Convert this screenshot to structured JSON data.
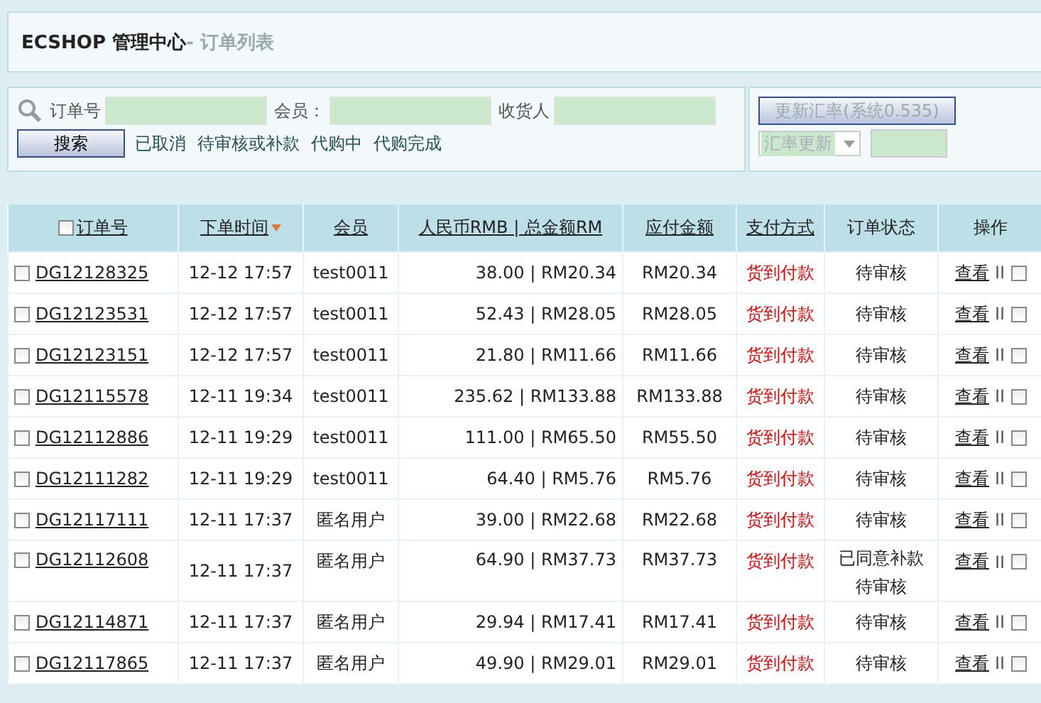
{
  "header": {
    "brand": "ECSHOP 管理中心",
    "page": "- 订单列表"
  },
  "search": {
    "fields": [
      {
        "label": "订单号"
      },
      {
        "label": "会员："
      },
      {
        "label": "收货人"
      }
    ],
    "button": "搜索",
    "filters": [
      "已取消",
      "待审核或补款",
      "代购中",
      "代购完成"
    ]
  },
  "rate": {
    "button": "更新汇率(系统0.535)",
    "select": "汇率更新"
  },
  "table": {
    "select_all_checked": false,
    "columns": [
      {
        "label": "订单号",
        "link": true,
        "sorted": false
      },
      {
        "label": "下单时间",
        "link": true,
        "sorted": true
      },
      {
        "label": "会员",
        "link": true,
        "sorted": false
      },
      {
        "label": "人民币RMB | 总金额RM",
        "link": true,
        "sorted": false
      },
      {
        "label": "应付金额",
        "link": true,
        "sorted": false
      },
      {
        "label": "支付方式",
        "link": true,
        "sorted": false
      },
      {
        "label": "订单状态",
        "link": false
      },
      {
        "label": "操作",
        "link": false
      }
    ],
    "rows": [
      {
        "checked": false,
        "order": "DG12128325",
        "time": "12-12 17:57",
        "member": "test0011",
        "amount": "38.00 | RM20.34",
        "payable": "RM20.34",
        "payment": "货到付款",
        "status": [
          "待审核"
        ],
        "action": "查看",
        "separator": "II",
        "action_checked": false
      },
      {
        "checked": false,
        "order": "DG12123531",
        "time": "12-12 17:57",
        "member": "test0011",
        "amount": "52.43 | RM28.05",
        "payable": "RM28.05",
        "payment": "货到付款",
        "status": [
          "待审核"
        ],
        "action": "查看",
        "separator": "II",
        "action_checked": false
      },
      {
        "checked": false,
        "order": "DG12123151",
        "time": "12-12 17:57",
        "member": "test0011",
        "amount": "21.80 | RM11.66",
        "payable": "RM11.66",
        "payment": "货到付款",
        "status": [
          "待审核"
        ],
        "action": "查看",
        "separator": "II",
        "action_checked": false
      },
      {
        "checked": false,
        "order": "DG12115578",
        "time": "12-11 19:34",
        "member": "test0011",
        "amount": "235.62 | RM133.88",
        "payable": "RM133.88",
        "payment": "货到付款",
        "status": [
          "待审核"
        ],
        "action": "查看",
        "separator": "II",
        "action_checked": false
      },
      {
        "checked": false,
        "order": "DG12112886",
        "time": "12-11 19:29",
        "member": "test0011",
        "amount": "111.00 | RM65.50",
        "payable": "RM55.50",
        "payment": "货到付款",
        "status": [
          "待审核"
        ],
        "action": "查看",
        "separator": "II",
        "action_checked": false
      },
      {
        "checked": false,
        "order": "DG12111282",
        "time": "12-11 19:29",
        "member": "test0011",
        "amount": "64.40 | RM5.76",
        "payable": "RM5.76",
        "payment": "货到付款",
        "status": [
          "待审核"
        ],
        "action": "查看",
        "separator": "II",
        "action_checked": false
      },
      {
        "checked": false,
        "order": "DG12117111",
        "time": "12-11 17:37",
        "member": "匿名用户",
        "amount": "39.00 | RM22.68",
        "payable": "RM22.68",
        "payment": "货到付款",
        "status": [
          "待审核"
        ],
        "action": "查看",
        "separator": "II",
        "action_checked": false
      },
      {
        "checked": false,
        "order": "DG12112608",
        "time": "12-11 17:37",
        "member": "匿名用户",
        "amount": "64.90 | RM37.73",
        "payable": "RM37.73",
        "payment": "货到付款",
        "status": [
          "已同意补款",
          "待审核"
        ],
        "action": "查看",
        "separator": "II",
        "action_checked": false
      },
      {
        "checked": false,
        "order": "DG12114871",
        "time": "12-11 17:37",
        "member": "匿名用户",
        "amount": "29.94 | RM17.41",
        "payable": "RM17.41",
        "payment": "货到付款",
        "status": [
          "待审核"
        ],
        "action": "查看",
        "separator": "II",
        "action_checked": false
      },
      {
        "checked": false,
        "order": "DG12117865",
        "time": "12-11 17:37",
        "member": "匿名用户",
        "amount": "49.90 | RM29.01",
        "payable": "RM29.01",
        "payment": "货到付款",
        "status": [
          "待审核"
        ],
        "action": "查看",
        "separator": "II",
        "action_checked": false
      }
    ]
  }
}
